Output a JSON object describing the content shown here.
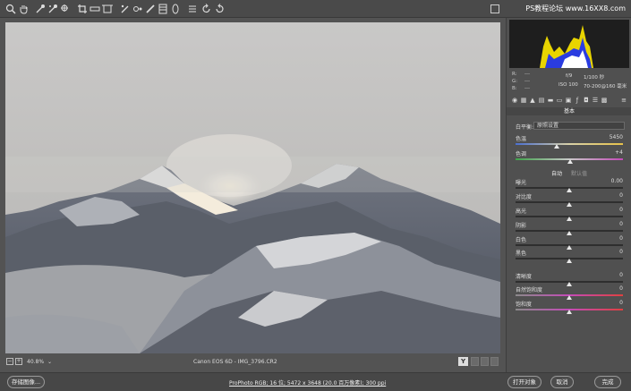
{
  "toolbar": {
    "tools": [
      "zoom-icon",
      "hand-icon",
      "white-balance-icon",
      "color-sampler-icon",
      "target-adjust-icon",
      "crop-icon",
      "straighten-icon",
      "transform-icon",
      "spot-removal-icon",
      "red-eye-icon",
      "adjustment-brush-icon",
      "graduated-filter-icon",
      "radial-filter-icon",
      "preferences-icon",
      "rotate-ccw-icon",
      "rotate-cw-icon"
    ],
    "watermark": "PS教程论坛 www.16XX8.com"
  },
  "preview_bar": {
    "zoom_out": "−",
    "zoom_in": "+",
    "zoom_value": "40.8%",
    "filename": "Canon EOS 6D -  IMG_3796.CR2",
    "view_toggle": "Y"
  },
  "info": {
    "r_label": "R:",
    "g_label": "G:",
    "b_label": "B:",
    "r_val": "---",
    "g_val": "---",
    "b_val": "---",
    "aperture": "f/9",
    "shutter": "1/100 秒",
    "iso": "ISO 100",
    "lens": "70-200@160 毫米"
  },
  "panel": {
    "section_title": "基本",
    "wb_label": "白平衡:",
    "wb_value": "原照设置",
    "auto_label": "自动",
    "default_label": "默认值",
    "sliders": [
      {
        "label": "色温",
        "value": "5450",
        "pos": 0.38
      },
      {
        "label": "色调",
        "value": "+4",
        "pos": 0.51
      },
      {
        "label": "曝光",
        "value": "0.00",
        "pos": 0.5
      },
      {
        "label": "对比度",
        "value": "0",
        "pos": 0.5
      },
      {
        "label": "高光",
        "value": "0",
        "pos": 0.5
      },
      {
        "label": "阴影",
        "value": "0",
        "pos": 0.5
      },
      {
        "label": "白色",
        "value": "0",
        "pos": 0.5
      },
      {
        "label": "黑色",
        "value": "0",
        "pos": 0.5
      },
      {
        "label": "清晰度",
        "value": "0",
        "pos": 0.5
      },
      {
        "label": "自然饱和度",
        "value": "0",
        "pos": 0.5
      },
      {
        "label": "饱和度",
        "value": "0",
        "pos": 0.5
      }
    ]
  },
  "bottom": {
    "save_label": "存储图像...",
    "workflow": "ProPhoto RGB; 16 位; 5472 x 3648 (20.0 百万像素); 300 ppi",
    "open_label": "打开对象",
    "cancel_label": "取消",
    "done_label": "完成"
  },
  "colors": {
    "accent": "#e8e8e8",
    "histo_yellow": "#e8d400",
    "histo_blue": "#2a3ce0"
  }
}
